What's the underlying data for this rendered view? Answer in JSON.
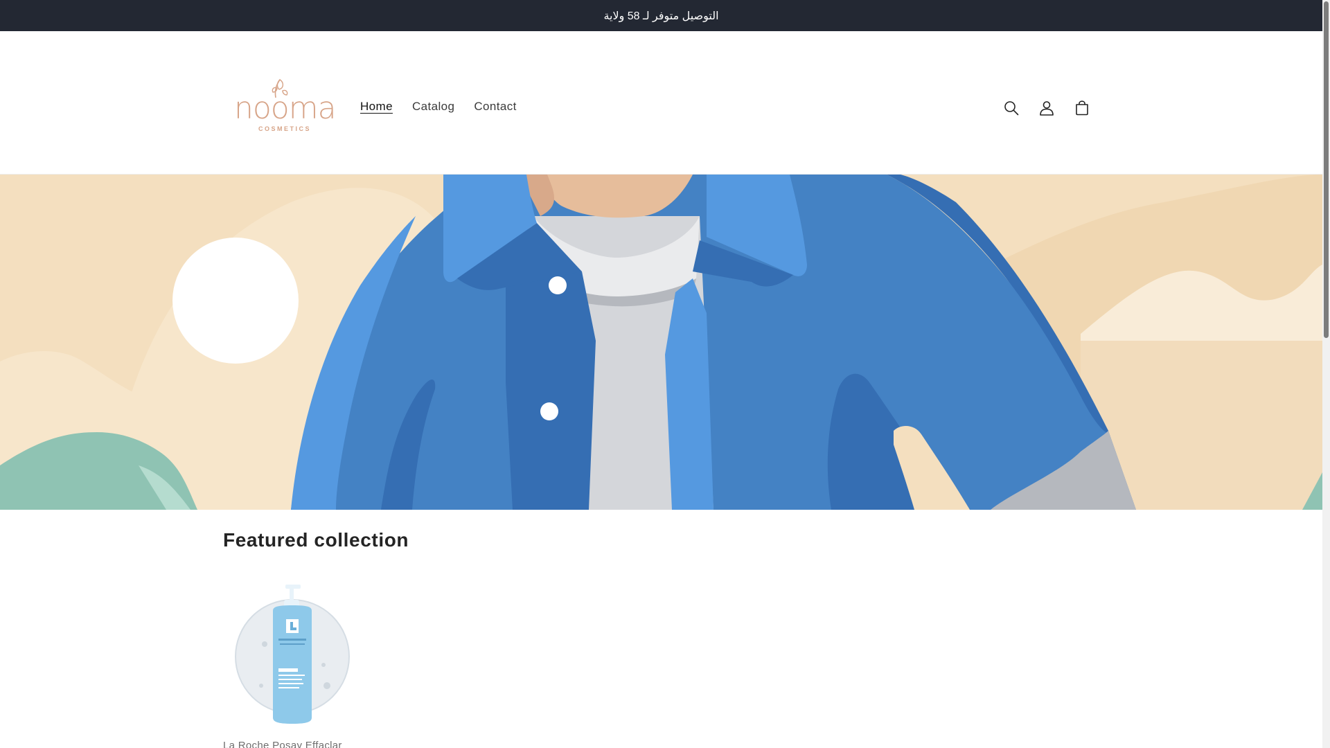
{
  "announcement": {
    "text": "التوصيل متوفر لـ 58 ولاية"
  },
  "brand": {
    "name": "nooma",
    "subtitle": "COSMETICS",
    "color": "#d7a488"
  },
  "nav": {
    "items": [
      {
        "label": "Home",
        "active": true
      },
      {
        "label": "Catalog",
        "active": false
      },
      {
        "label": "Contact",
        "active": false
      }
    ]
  },
  "header_icons": [
    {
      "name": "search-icon",
      "action": "search"
    },
    {
      "name": "account-icon",
      "action": "log in"
    },
    {
      "name": "cart-icon",
      "action": "cart"
    }
  ],
  "featured": {
    "heading": "Featured collection",
    "products": [
      {
        "title": "La Roche Posay Effaclar"
      }
    ]
  },
  "colors": {
    "announcement_bg": "#232833",
    "hero_sand": "#f4dfbf",
    "jacket_blue": "#4482c4",
    "mint": "#8fc3b3"
  }
}
